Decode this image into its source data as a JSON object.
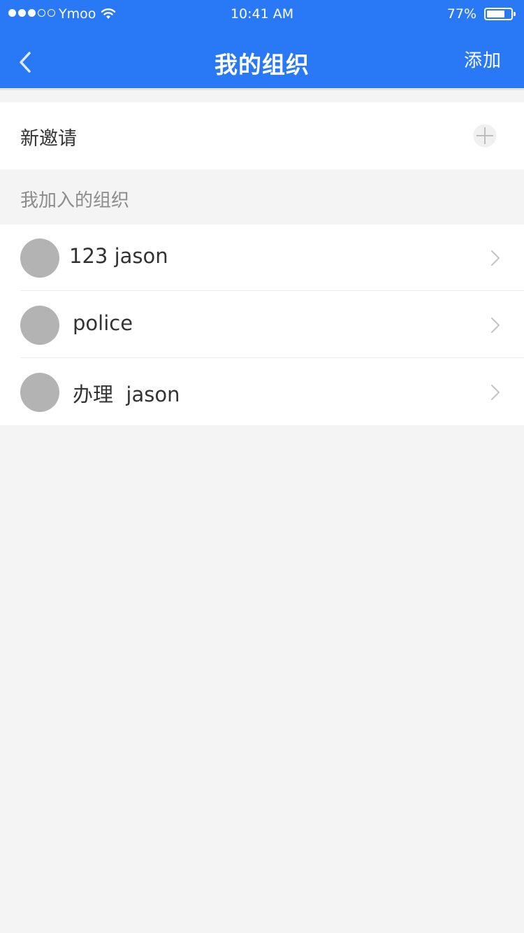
{
  "status_bar": {
    "carrier": "Ymoo",
    "time": "10:41 AM",
    "battery_percent": "77%",
    "battery_level": 0.77,
    "signal_bars": 3,
    "signal_total": 5
  },
  "nav": {
    "title": "我的组织",
    "add_label": "添加",
    "back_icon": "chevron-left-icon"
  },
  "invite": {
    "label": "新邀请",
    "icon": "plus-circle-icon"
  },
  "joined_section": {
    "title": "我加入的组织"
  },
  "organizations": [
    {
      "name": "123 jason"
    },
    {
      "name": "police"
    },
    {
      "name": "办理  jason"
    }
  ],
  "colors": {
    "header_blue": "#2979f6",
    "background": "#f4f4f4",
    "avatar_gray": "#b3b3b3"
  }
}
